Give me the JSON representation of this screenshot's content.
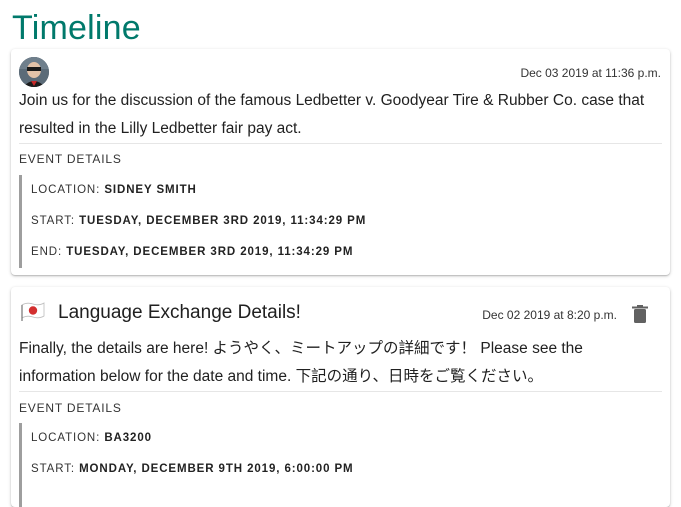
{
  "page": {
    "title": "Timeline"
  },
  "events": [
    {
      "timestamp": "Dec 03 2019 at 11:36 p.m.",
      "heading": "",
      "body": "Join us for the discussion of the famous Ledbetter v. Goodyear Tire & Rubber Co. case that resulted in the Lilly Ledbetter fair pay act.",
      "details_label": "EVENT DETAILS",
      "location_label": "LOCATION:",
      "location": "SIDNEY SMITH",
      "start_label": "START:",
      "start": "TUESDAY, DECEMBER 3RD 2019, 11:34:29 PM",
      "end_label": "END:",
      "end": "TUESDAY, DECEMBER 3RD 2019, 11:34:29 PM"
    },
    {
      "timestamp": "Dec 02 2019 at 8:20 p.m.",
      "heading": "Language Exchange Details!",
      "body": "Finally, the details are here! ようやく、ミートアップの詳細です！ Please see the information below for the date and time. 下記の通り、日時をご覧ください。",
      "details_label": "EVENT DETAILS",
      "location_label": "LOCATION:",
      "location": "BA3200",
      "start_label": "START:",
      "start": "MONDAY, DECEMBER 9TH 2019, 6:00:00 PM"
    }
  ],
  "icons": {
    "card1_avatar": "user-avatar",
    "card2_avatar": "japan-flag-icon",
    "delete": "trash-icon"
  },
  "colors": {
    "title": "#00796b",
    "details_bar": "#9e9e9e"
  }
}
